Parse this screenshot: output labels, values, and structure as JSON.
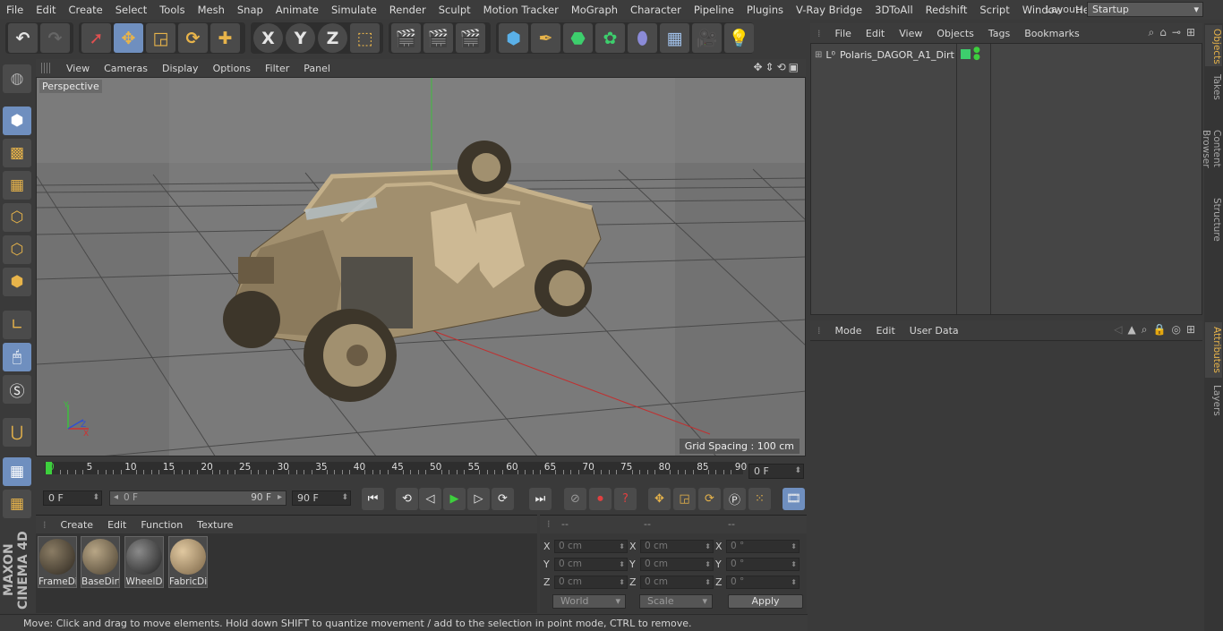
{
  "menubar": {
    "items": [
      "File",
      "Edit",
      "Create",
      "Select",
      "Tools",
      "Mesh",
      "Snap",
      "Animate",
      "Simulate",
      "Render",
      "Sculpt",
      "Motion Tracker",
      "MoGraph",
      "Character",
      "Pipeline",
      "Plugins",
      "V-Ray Bridge",
      "3DToAll",
      "Redshift",
      "Script",
      "Window",
      "Help"
    ],
    "layout_label": "Layout:",
    "layout_value": "Startup"
  },
  "toolbar": {
    "axis_x": "X",
    "axis_y": "Y",
    "axis_z": "Z"
  },
  "viewport": {
    "menu": [
      "View",
      "Cameras",
      "Display",
      "Options",
      "Filter",
      "Panel"
    ],
    "label": "Perspective",
    "grid_spacing": "Grid Spacing : 100 cm"
  },
  "timeline": {
    "ticks": [
      "0",
      "5",
      "10",
      "15",
      "20",
      "25",
      "30",
      "35",
      "40",
      "45",
      "50",
      "55",
      "60",
      "65",
      "70",
      "75",
      "80",
      "85",
      "90"
    ],
    "current_frame": "0 F"
  },
  "playbar": {
    "start": "0 F",
    "range_start": "0 F",
    "range_end": "90 F",
    "end": "90 F"
  },
  "materials": {
    "menu": [
      "Create",
      "Edit",
      "Function",
      "Texture"
    ],
    "items": [
      {
        "name": "FrameDi"
      },
      {
        "name": "BaseDirt"
      },
      {
        "name": "WheelD"
      },
      {
        "name": "FabricDi"
      }
    ]
  },
  "coordinates": {
    "headers": [
      "--",
      "--",
      "--"
    ],
    "rows": [
      {
        "axis": "X",
        "pos": "0 cm",
        "size": "0 cm",
        "rot": "0 °"
      },
      {
        "axis": "Y",
        "pos": "0 cm",
        "size": "0 cm",
        "rot": "0 °"
      },
      {
        "axis": "Z",
        "pos": "0 cm",
        "size": "0 cm",
        "rot": "0 °"
      }
    ],
    "rot_labels": [
      "X",
      "Y",
      "Z"
    ],
    "size_labels": [
      "X",
      "Y",
      "Z"
    ],
    "world": "World",
    "scale": "Scale",
    "apply": "Apply"
  },
  "status": "Move: Click and drag to move elements. Hold down SHIFT to quantize movement / add to the selection in point mode, CTRL to remove.",
  "objects": {
    "menu": [
      "File",
      "Edit",
      "View",
      "Objects",
      "Tags",
      "Bookmarks"
    ],
    "items": [
      {
        "name": "Polaris_DAGOR_A1_Dirt"
      }
    ]
  },
  "attributes": {
    "menu": [
      "Mode",
      "Edit",
      "User Data"
    ]
  },
  "side_tabs": [
    "Objects",
    "Takes",
    "Content Browser",
    "Structure",
    "Attributes",
    "Layers"
  ],
  "logo": "MAXON CINEMA 4D",
  "colors": {
    "accent": "#6f8fbf",
    "highlight": "#e8b44a",
    "play": "#3dcf3d"
  }
}
